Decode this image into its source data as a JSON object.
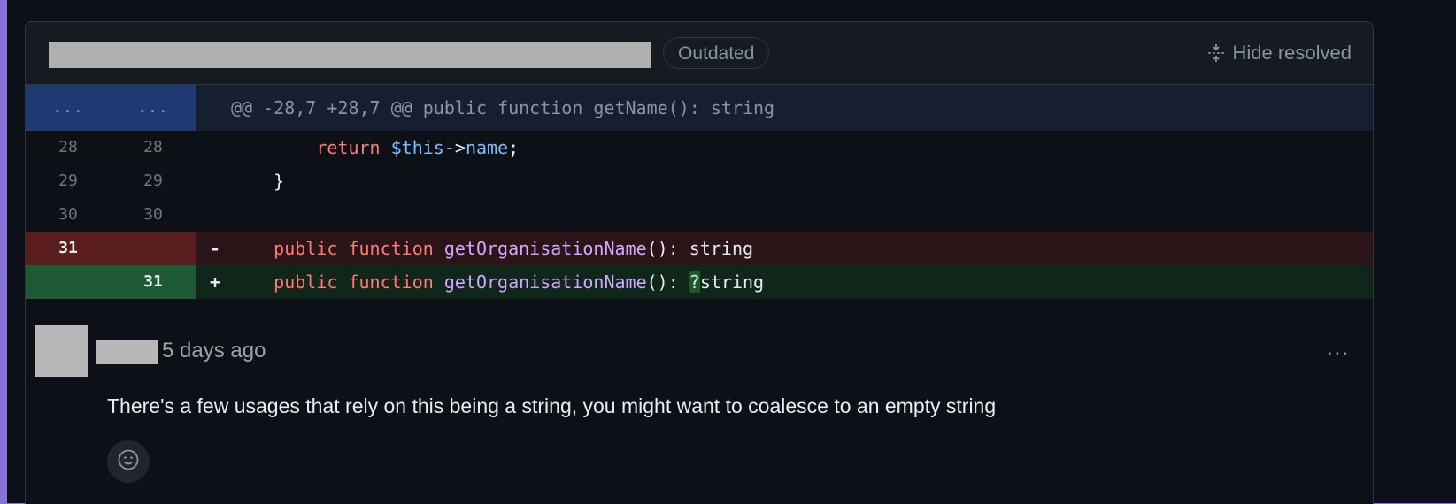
{
  "header": {
    "badge": "Outdated",
    "hide_resolved": "Hide resolved"
  },
  "diff": {
    "hunk": {
      "left_num": "...",
      "right_num": "...",
      "text": "@@ -28,7 +28,7 @@ public function getName(): string"
    },
    "context_rows": [
      {
        "left": "28",
        "right": "28",
        "code": "        return $this->name;"
      },
      {
        "left": "29",
        "right": "29",
        "code": "    }"
      },
      {
        "left": "30",
        "right": "30",
        "code": ""
      }
    ],
    "deleted": {
      "left": "31",
      "sign": "-",
      "code": "    public function getOrganisationName(): string"
    },
    "added": {
      "right": "31",
      "sign": "+",
      "code": "    public function getOrganisationName(): ?string"
    }
  },
  "comment": {
    "time": "5 days ago",
    "body": "There's a few usages that rely on this being a string, you might want to coalesce to an empty string",
    "more": "..."
  },
  "icons": {
    "hide_resolved": "unfold-icon",
    "reaction": "smiley-icon"
  },
  "colors": {
    "background": "#8873d6",
    "panel": "#0d1117",
    "hunk": "#1f3a72",
    "deleted": "#5a1e1e",
    "added": "#1e5a34"
  }
}
